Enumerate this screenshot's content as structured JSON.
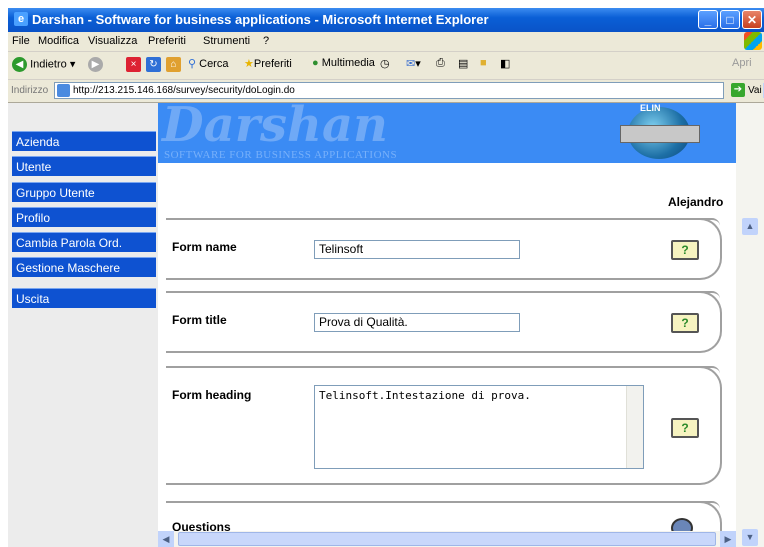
{
  "window": {
    "title": "Darshan - Software for business applications - Microsoft Internet Explorer"
  },
  "menu": [
    "File",
    "Modifica",
    "Visualizza",
    "Preferiti",
    "Strumenti",
    "?"
  ],
  "toolbar": {
    "back": "Indietro",
    "search": "Cerca",
    "favorites": "Preferiti",
    "media": "Multimedia",
    "open": "Apri"
  },
  "address": {
    "label": "Indirizzo",
    "url": "http://213.215.146.168/survey/security/doLogin.do",
    "go": "Vai"
  },
  "sidebar": {
    "items": [
      {
        "label": "Azienda"
      },
      {
        "label": "Utente"
      },
      {
        "label": "Gruppo Utente"
      },
      {
        "label": "Profilo"
      },
      {
        "label": "Cambia Parola Ord."
      },
      {
        "label": "Gestione Maschere"
      },
      {
        "label": "Uscita"
      }
    ]
  },
  "banner": {
    "logo": "Darshan",
    "tagline": "SOFTWARE FOR BUSINESS APPLICATIONS"
  },
  "user": {
    "name": "Alejandro"
  },
  "form": {
    "name_label": "Form name",
    "name_value": "Telinsoft",
    "title_label": "Form title",
    "title_value": "Prova di Qualità.",
    "heading_label": "Form heading",
    "heading_value": "Telinsoft.Intestazione di prova.",
    "questions_label": "Questions",
    "help_glyph": "?"
  },
  "icons": {
    "help": "help-icon",
    "back": "back-arrow-icon",
    "forward": "forward-arrow-icon",
    "search": "search-icon",
    "favorites": "star-icon"
  }
}
